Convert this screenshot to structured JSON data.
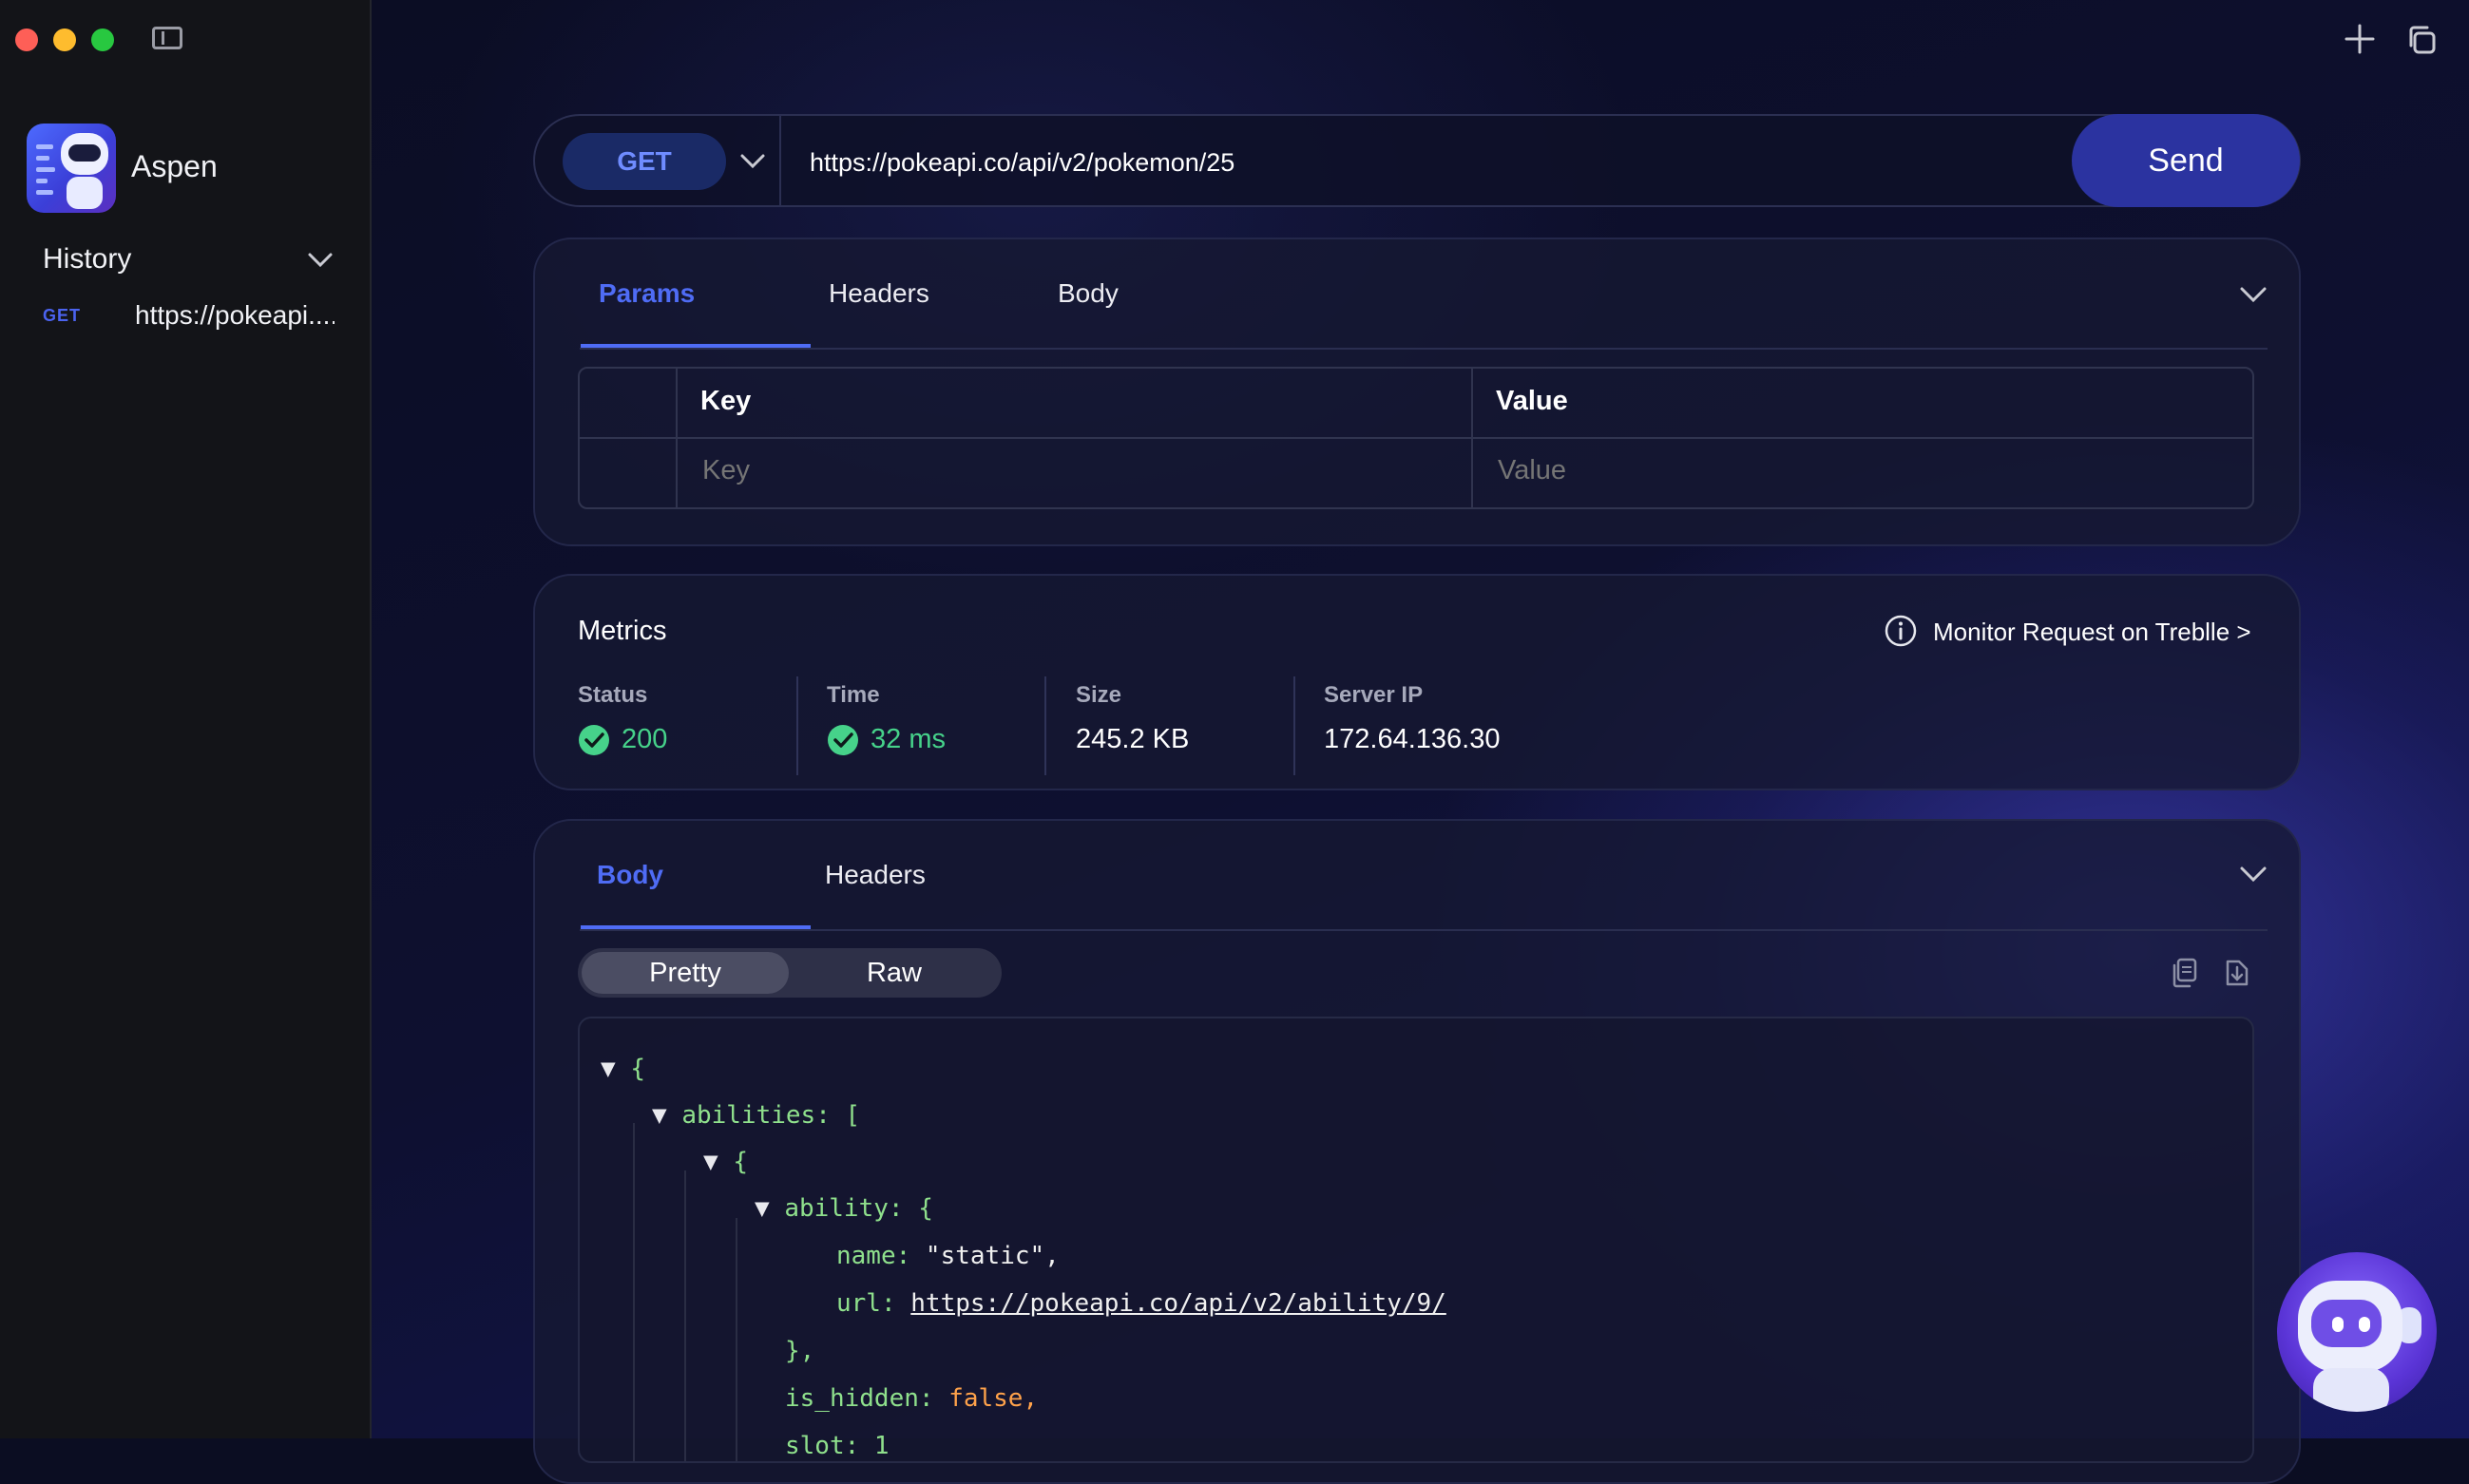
{
  "app": {
    "name": "Aspen"
  },
  "sidebar": {
    "history_label": "History",
    "items": [
      {
        "method": "GET",
        "url": "https://pokeapi...."
      }
    ]
  },
  "request": {
    "method": "GET",
    "url": "https://pokeapi.co/api/v2/pokemon/25",
    "send_label": "Send",
    "tabs": [
      {
        "label": "Params",
        "active": true
      },
      {
        "label": "Headers",
        "active": false
      },
      {
        "label": "Body",
        "active": false
      }
    ],
    "params_table": {
      "key_header": "Key",
      "value_header": "Value",
      "key_placeholder": "Key",
      "value_placeholder": "Value"
    }
  },
  "metrics": {
    "title": "Metrics",
    "monitor_link": "Monitor Request on Treblle >",
    "status": {
      "label": "Status",
      "value": "200"
    },
    "time": {
      "label": "Time",
      "value": "32 ms"
    },
    "size": {
      "label": "Size",
      "value": "245.2 KB"
    },
    "server_ip": {
      "label": "Server IP",
      "value": "172.64.136.30"
    }
  },
  "response": {
    "tabs": [
      {
        "label": "Body",
        "active": true
      },
      {
        "label": "Headers",
        "active": false
      }
    ],
    "view_modes": {
      "pretty": "Pretty",
      "raw": "Raw",
      "selected": "Pretty"
    },
    "code": {
      "l1_brace": "{",
      "l2_key": "abilities: [",
      "l3_brace": "{",
      "l4_key": "ability: {",
      "l5_key": "name: ",
      "l5_val": "\"static\",",
      "l6_key": "url: ",
      "l6_val": "https://pokeapi.co/api/v2/ability/9/",
      "l7": "},",
      "l8_key": "is_hidden: ",
      "l8_val": "false,",
      "l9": "slot: 1"
    }
  },
  "colors": {
    "accent": "#4f6cf5",
    "send_button": "#2b33a0",
    "success": "#46d28a",
    "json_key": "#8fe08c",
    "json_boolean": "#ffa24a"
  },
  "icons": [
    "sidebar-toggle-icon",
    "chevron-down-icon",
    "plus-icon",
    "duplicate-window-icon",
    "info-icon",
    "check-circle-icon",
    "copy-icon",
    "download-icon"
  ]
}
